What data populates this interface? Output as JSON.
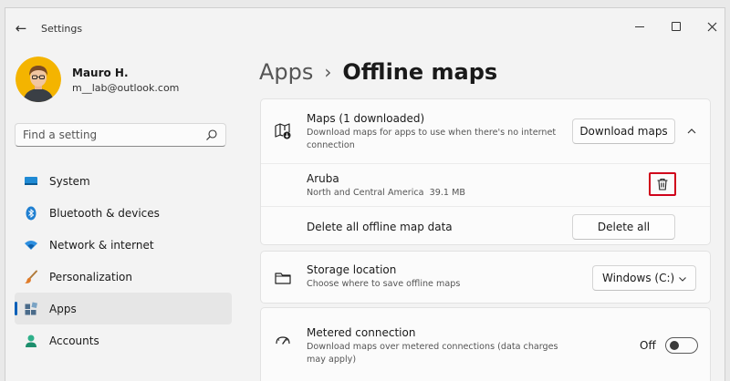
{
  "window": {
    "title": "Settings"
  },
  "profile": {
    "name": "Mauro H.",
    "email": "m__lab@outlook.com"
  },
  "search": {
    "placeholder": "Find a setting"
  },
  "sidebar": {
    "items": [
      {
        "label": "System",
        "icon": "monitor-icon"
      },
      {
        "label": "Bluetooth & devices",
        "icon": "bluetooth-icon"
      },
      {
        "label": "Network & internet",
        "icon": "wifi-icon"
      },
      {
        "label": "Personalization",
        "icon": "brush-icon"
      },
      {
        "label": "Apps",
        "icon": "apps-icon",
        "active": true
      },
      {
        "label": "Accounts",
        "icon": "person-icon"
      }
    ]
  },
  "breadcrumb": {
    "parent": "Apps",
    "separator": "›",
    "current": "Offline maps"
  },
  "maps": {
    "title": "Maps (1 downloaded)",
    "description": "Download maps for apps to use when there's no internet connection",
    "download_label": "Download maps",
    "item": {
      "name": "Aruba",
      "region": "North and Central America",
      "size": "39.1 MB"
    },
    "delete_all_text": "Delete all offline map data",
    "delete_all_label": "Delete all"
  },
  "storage": {
    "title": "Storage location",
    "description": "Choose where to save offline maps",
    "selected": "Windows (C:)"
  },
  "metered": {
    "title": "Metered connection",
    "description": "Download maps over metered connections (data charges may apply)",
    "state_label": "Off"
  },
  "colors": {
    "accent": "#005fb8",
    "highlight": "#d0021b"
  }
}
